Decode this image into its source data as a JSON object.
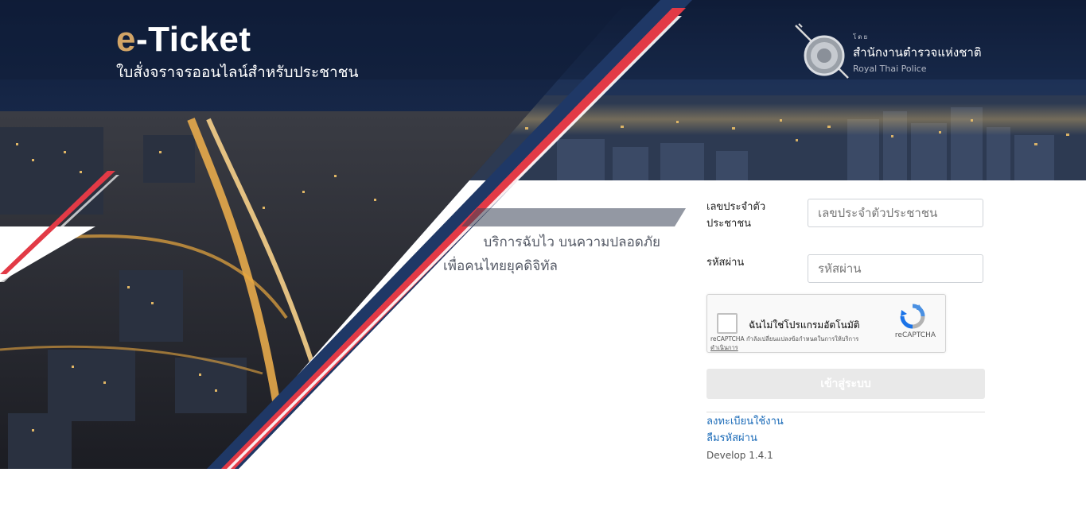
{
  "brand": {
    "e": "e",
    "title_rest": "-Ticket",
    "subtitle": "ใบสั่งจราจรออนไลน์สำหรับประชาชน"
  },
  "agency": {
    "prefix": "โดย",
    "name_th": "สำนักงานตำรวจแห่งชาติ",
    "name_en": "Royal Thai Police",
    "seal_icon": "royal-thai-police-seal"
  },
  "tagline": {
    "line1": "บริการฉับไว บนความปลอดภัย",
    "line2": "เพื่อคนไทยยุคดิจิทัล"
  },
  "form": {
    "id_label": "เลขประจำตัว\nประชาชน",
    "id_label_l1": "เลขประจำตัว",
    "id_label_l2": "ประชาชน",
    "id_placeholder": "เลขประจำตัวประชาชน",
    "password_label": "รหัสผ่าน",
    "password_placeholder": "รหัสผ่าน",
    "login_button": "เข้าสู่ระบบ"
  },
  "recaptcha": {
    "checkbox_label": "ฉันไม่ใช่โปรแกรมอัตโนมัติ",
    "brand": "reCAPTCHA",
    "terms_text": "reCAPTCHA กำลังเปลี่ยนแปลงข้อกำหนดในการให้บริการ",
    "terms_link": "ดำเนินการ"
  },
  "links": {
    "register": "ลงทะเบียนใช้งาน",
    "forgot_password": "ลืมรหัสผ่าน"
  },
  "version": "Develop  1.4.1",
  "colors": {
    "accent_gold": "#d2a466",
    "stripe_red": "#e23a46",
    "stripe_navy": "#1f3866",
    "link_blue": "#1b6bb8",
    "night_sky": "#14223e"
  }
}
